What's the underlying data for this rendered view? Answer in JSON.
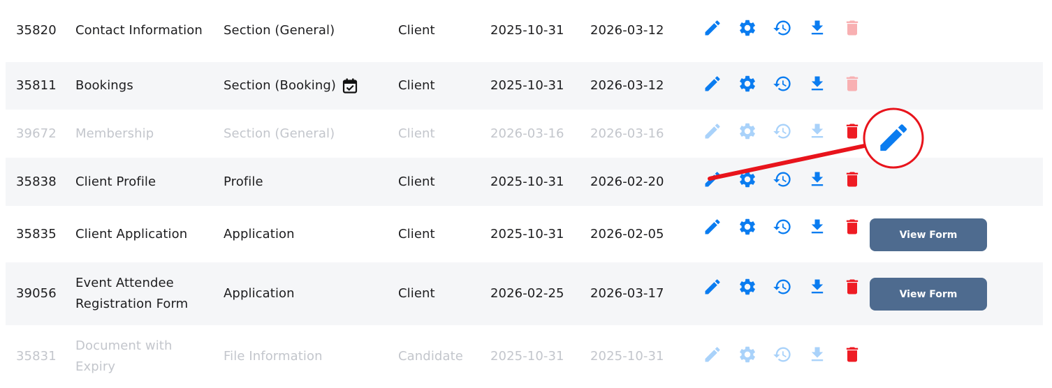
{
  "colors": {
    "primary": "#0a7cf0",
    "primary_muted": "#a9d2fa",
    "danger": "#ee1c24",
    "danger_muted": "#f8b0b2",
    "button": "#4e6b8f",
    "annotation": "#e8141c"
  },
  "rows": [
    {
      "id": "35820",
      "name": "Contact Information",
      "type": "Section (General)",
      "owner": "Client",
      "created": "2025-10-31",
      "modified": "2026-03-12",
      "state": "active",
      "delete": "muted"
    },
    {
      "id": "35811",
      "name": "Bookings",
      "type": "Section (Booking)",
      "owner": "Client",
      "created": "2025-10-31",
      "modified": "2026-03-12",
      "state": "active",
      "delete": "muted",
      "type_icon": "calendar-check-icon"
    },
    {
      "id": "39672",
      "name": "Membership",
      "type": "Section (General)",
      "owner": "Client",
      "created": "2026-03-16",
      "modified": "2026-03-16",
      "state": "muted",
      "delete": "active"
    },
    {
      "id": "35838",
      "name": "Client Profile",
      "type": "Profile",
      "owner": "Client",
      "created": "2025-10-31",
      "modified": "2026-02-20",
      "state": "active",
      "delete": "active"
    },
    {
      "id": "35835",
      "name": "Client Application",
      "type": "Application",
      "owner": "Client",
      "created": "2025-10-31",
      "modified": "2026-02-05",
      "state": "active",
      "delete": "active",
      "button": "View Form"
    },
    {
      "id": "39056",
      "name": "Event Attendee Registration Form",
      "type": "Application",
      "owner": "Client",
      "created": "2026-02-25",
      "modified": "2026-03-17",
      "state": "active",
      "delete": "active",
      "button": "View Form"
    },
    {
      "id": "35831",
      "name": "Document with Expiry",
      "type": "File Information",
      "owner": "Candidate",
      "created": "2025-10-31",
      "modified": "2025-10-31",
      "state": "muted",
      "delete": "active"
    }
  ],
  "action_icons": [
    "pencil-icon",
    "gear-icon",
    "history-icon",
    "download-icon",
    "trash-icon"
  ],
  "annotation": {
    "icon": "pencil-icon",
    "shape": "circle-callout-with-pointer"
  }
}
